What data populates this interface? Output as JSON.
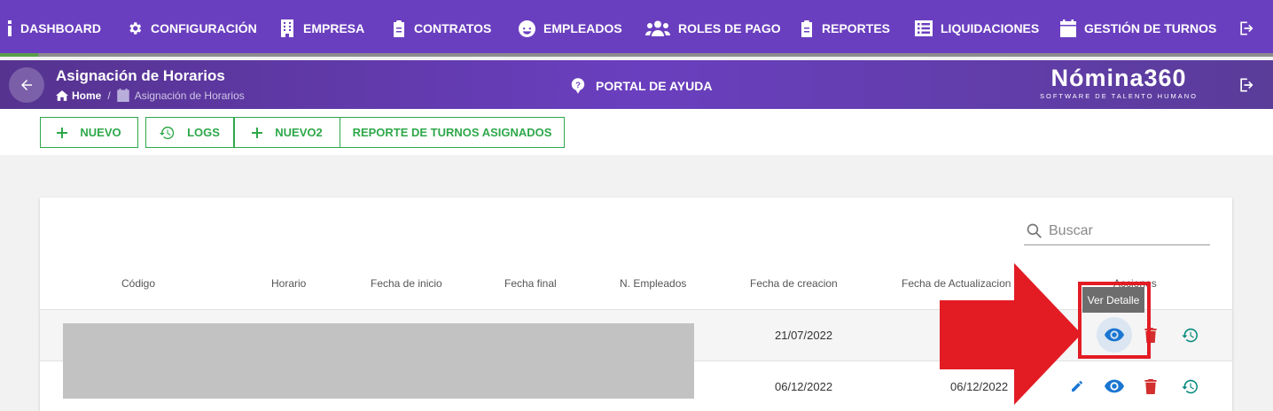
{
  "nav": {
    "items": [
      {
        "label": "DASHBOARD",
        "icon": "dashboard-icon"
      },
      {
        "label": "CONFIGURACIÓN",
        "icon": "gear-icon"
      },
      {
        "label": "EMPRESA",
        "icon": "building-icon"
      },
      {
        "label": "CONTRATOS",
        "icon": "clipboard-icon"
      },
      {
        "label": "EMPLEADOS",
        "icon": "face-icon"
      },
      {
        "label": "ROLES DE PAGO",
        "icon": "users-icon"
      },
      {
        "label": "REPORTES",
        "icon": "clipboard-icon"
      },
      {
        "label": "LIQUIDACIONES",
        "icon": "list-icon"
      },
      {
        "label": "GESTIÓN DE TURNOS",
        "icon": "calendar-icon"
      }
    ],
    "logout_icon": "logout-icon",
    "progress": 0.03
  },
  "subheader": {
    "title": "Asignación de Horarios",
    "breadcrumb": {
      "home": "Home",
      "current": "Asignación de Horarios"
    },
    "help": "PORTAL DE AYUDA",
    "brand": {
      "name": "Nómina360",
      "tagline": "SOFTWARE DE TALENTO HUMANO"
    }
  },
  "toolbar": {
    "nuevo": "NUEVO",
    "logs": "LOGS",
    "nuevo2": "NUEVO2",
    "reporte": "REPORTE DE TURNOS ASIGNADOS"
  },
  "search": {
    "placeholder": "Buscar"
  },
  "table": {
    "headers": [
      "Código",
      "Horario",
      "Fecha de inicio",
      "Fecha final",
      "N. Empleados",
      "Fecha de creacion",
      "Fecha de Actualizacion",
      "Acciones"
    ],
    "rows": [
      {
        "fecha_creacion": "21/07/2022",
        "fecha_actualizacion": ""
      },
      {
        "fecha_creacion": "06/12/2022",
        "fecha_actualizacion": "06/12/2022"
      }
    ]
  },
  "tooltip": "Ver Detalle",
  "colors": {
    "primary": "#6a3fbf",
    "green": "#2ea84a",
    "blue": "#1976d2",
    "red": "#d32f2f",
    "teal": "#00897b",
    "annotation": "#e31c24"
  }
}
